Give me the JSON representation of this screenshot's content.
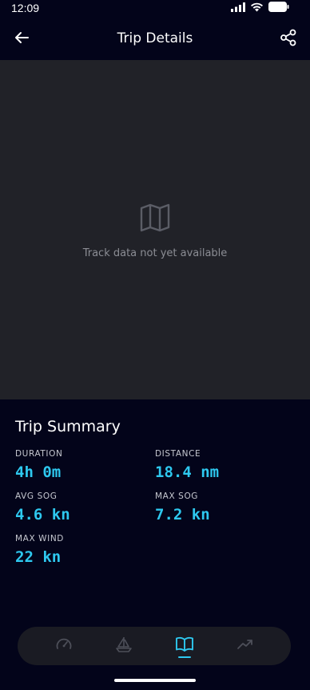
{
  "status_bar": {
    "time": "12:09"
  },
  "header": {
    "title": "Trip Details"
  },
  "map": {
    "empty_message": "Track data not yet available"
  },
  "summary": {
    "title": "Trip Summary",
    "stats": [
      {
        "label": "DURATION",
        "value": "4h 0m"
      },
      {
        "label": "DISTANCE",
        "value": "18.4 nm"
      },
      {
        "label": "AVG SOG",
        "value": "4.6 kn"
      },
      {
        "label": "MAX SOG",
        "value": "7.2 kn"
      },
      {
        "label": "MAX WIND",
        "value": "22 kn"
      }
    ]
  },
  "nav": {
    "items": [
      {
        "icon": "speedometer-icon",
        "active": false
      },
      {
        "icon": "sailboat-icon",
        "active": false
      },
      {
        "icon": "logbook-icon",
        "active": true
      },
      {
        "icon": "trend-icon",
        "active": false
      }
    ]
  },
  "colors": {
    "background": "#03041a",
    "map_background": "#212228",
    "accent": "#2ec8ef",
    "nav_background": "#1a1b23"
  }
}
